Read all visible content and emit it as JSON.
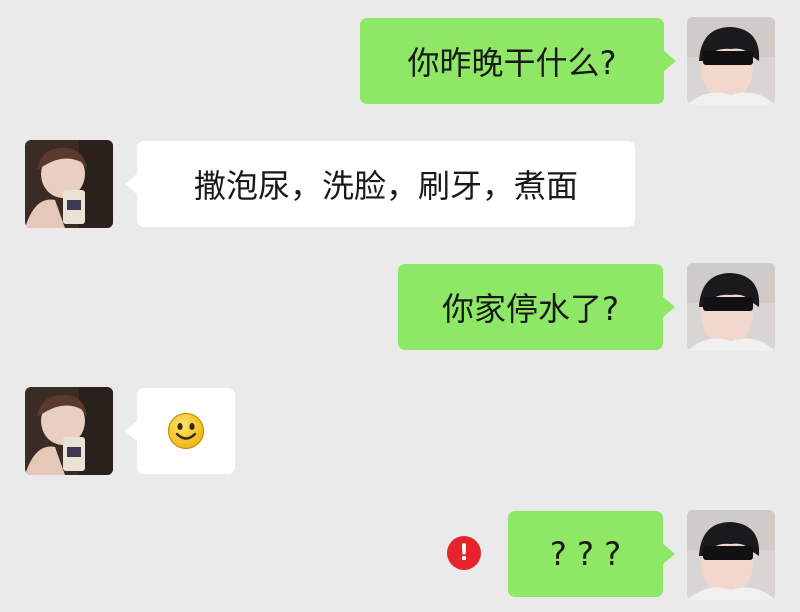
{
  "conversation": {
    "messages": [
      {
        "sender": "me",
        "text": "你昨晚干什么?"
      },
      {
        "sender": "contact",
        "text": "撒泡尿，洗脸，刷牙，煮面"
      },
      {
        "sender": "me",
        "text": "你家停水了?"
      },
      {
        "sender": "contact",
        "text": "",
        "emoji": "smiling-face"
      },
      {
        "sender": "me",
        "text": "? ? ?",
        "status": "send-failed",
        "status_icon_text": "!"
      }
    ]
  },
  "colors": {
    "background": "#ebeaeb",
    "outgoing_bubble": "#8ee866",
    "incoming_bubble": "#ffffff",
    "error_badge": "#e6242b",
    "emoji_face": "#f7c21a"
  }
}
